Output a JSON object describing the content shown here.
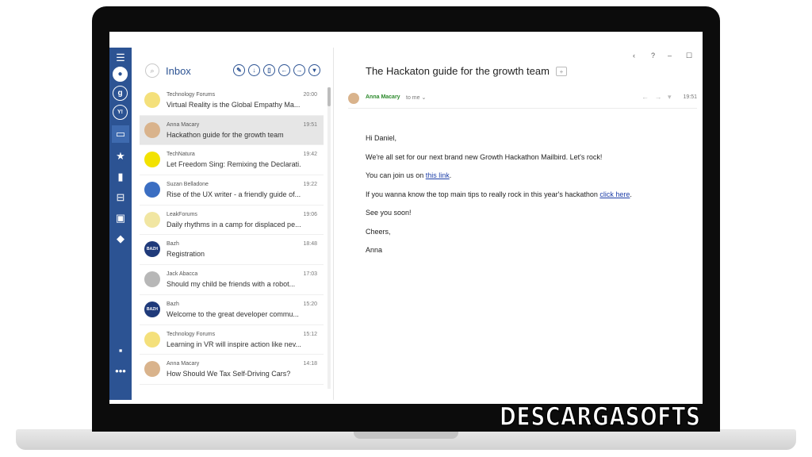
{
  "list": {
    "title": "Inbox",
    "messages": [
      {
        "sender": "Technology Forums",
        "time": "20:00",
        "subject": "Virtual Reality is the Global Empathy Ma...",
        "avatar_bg": "#f4e07b",
        "avatar_text": "",
        "selected": false
      },
      {
        "sender": "Anna Macary",
        "time": "19:51",
        "subject": "Hackathon guide for the growth team",
        "avatar_bg": "#d9b38c",
        "avatar_text": "",
        "selected": true
      },
      {
        "sender": "TechNatura",
        "time": "19:42",
        "subject": "Let Freedom Sing: Remixing the Declarati...",
        "avatar_bg": "#f2e200",
        "avatar_text": "",
        "selected": false
      },
      {
        "sender": "Suzan Belladone",
        "time": "19:22",
        "subject": "Rise of the UX writer - a friendly guide of...",
        "avatar_bg": "#3b6ec2",
        "avatar_text": "",
        "selected": false
      },
      {
        "sender": "LeakForums",
        "time": "19:06",
        "subject": "Daily rhythms in a camp for displaced pe...",
        "avatar_bg": "#f1e6a2",
        "avatar_text": "",
        "selected": false
      },
      {
        "sender": "Bazh",
        "time": "18:48",
        "subject": "Registration",
        "avatar_bg": "#1f3a7a",
        "avatar_text": "BAZH",
        "selected": false
      },
      {
        "sender": "Jack Abacca",
        "time": "17:03",
        "subject": "Should my child be friends with a robot...",
        "avatar_bg": "#b7b7b7",
        "avatar_text": "",
        "selected": false
      },
      {
        "sender": "Bazh",
        "time": "15:20",
        "subject": "Welcome to the great developer commu...",
        "avatar_bg": "#1f3a7a",
        "avatar_text": "BAZH",
        "selected": false
      },
      {
        "sender": "Technology Forums",
        "time": "15:12",
        "subject": "Learning in VR will inspire action like nev...",
        "avatar_bg": "#f4e07b",
        "avatar_text": "",
        "selected": false
      },
      {
        "sender": "Anna Macary",
        "time": "14:18",
        "subject": "How Should We Tax Self-Driving Cars?",
        "avatar_bg": "#d9b38c",
        "avatar_text": "",
        "selected": false
      }
    ]
  },
  "email": {
    "subject": "The Hackaton guide for the growth team",
    "from_name": "Anna Macary",
    "to": "to me",
    "time": "19:51",
    "greeting": "Hi Daniel,",
    "line1": "We're all set for our next brand new Growth Hackathon Mailbird. Let's rock!",
    "line2_prefix": "You can join us on ",
    "line2_link": "this link",
    "line2_suffix": ".",
    "line3_prefix": "If you wanna know the top main tips to really rock in this year's hackathon ",
    "line3_link": "click here",
    "line3_suffix": ".",
    "line4": "See you soon!",
    "closing": "Cheers,",
    "signature": "Anna"
  },
  "window_controls": {
    "back": "‹",
    "help": "?",
    "minimize": "–",
    "maximize": "☐"
  },
  "nav_accounts": {
    "google": "g",
    "yahoo": "Y!"
  },
  "watermark": "DESCARGASOFTS",
  "colors": {
    "sidebar": "#2c5393",
    "accent": "#2c5393",
    "link": "#1e3fa8",
    "sender_green": "#2c8a2c"
  }
}
